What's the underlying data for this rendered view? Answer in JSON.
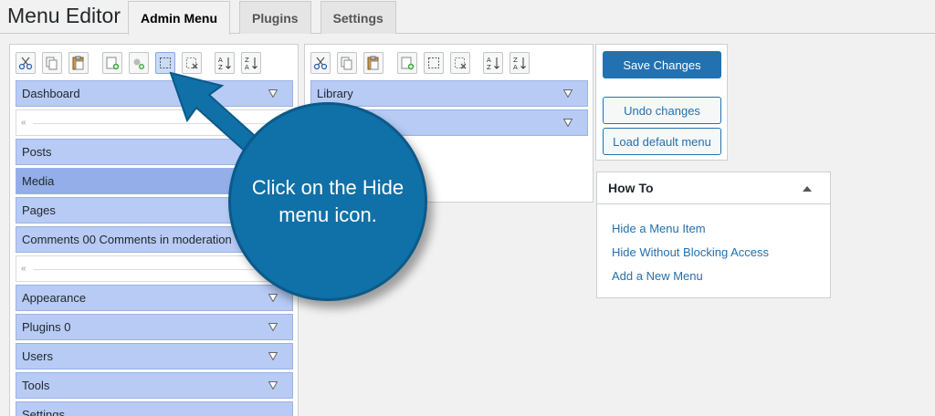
{
  "header": {
    "title": "Menu Editor",
    "tabs": [
      {
        "label": "Admin Menu",
        "active": true
      },
      {
        "label": "Plugins",
        "active": false
      },
      {
        "label": "Settings",
        "active": false
      }
    ]
  },
  "left_toolbar": [
    "cut-icon",
    "copy-icon",
    "paste-icon",
    "new-menu-icon",
    "new-separator-icon",
    "hide-menu-icon",
    "delete-icon",
    "sort-ascending-icon",
    "sort-descending-icon"
  ],
  "right_toolbar": [
    "cut-icon",
    "copy-icon",
    "paste-icon",
    "new-menu-icon",
    "hide-menu-icon",
    "delete-icon",
    "sort-ascending-icon",
    "sort-descending-icon"
  ],
  "left_menu": [
    {
      "type": "item",
      "label": "Dashboard"
    },
    {
      "type": "separator"
    },
    {
      "type": "item",
      "label": "Posts"
    },
    {
      "type": "item",
      "label": "Media",
      "selected": true
    },
    {
      "type": "item",
      "label": "Pages"
    },
    {
      "type": "item",
      "label": "Comments 00 Comments in moderation"
    },
    {
      "type": "separator"
    },
    {
      "type": "item",
      "label": "Appearance"
    },
    {
      "type": "item",
      "label": "Plugins 0"
    },
    {
      "type": "item",
      "label": "Users"
    },
    {
      "type": "item",
      "label": "Tools"
    },
    {
      "type": "item",
      "label": "Settings"
    }
  ],
  "right_menu": [
    {
      "label": "Library"
    },
    {
      "label": ""
    }
  ],
  "actions": {
    "save": "Save Changes",
    "undo": "Undo changes",
    "load_default": "Load default menu"
  },
  "howto": {
    "title": "How To",
    "links": [
      "Hide a Menu Item",
      "Hide Without Blocking Access",
      "Add a New Menu"
    ]
  },
  "callout": {
    "text": "Click on the Hide menu icon."
  },
  "colors": {
    "accent": "#2271b1",
    "item_bg": "#b7cbf5",
    "item_selected": "#93aee9",
    "callout_bg": "#1070a8"
  }
}
